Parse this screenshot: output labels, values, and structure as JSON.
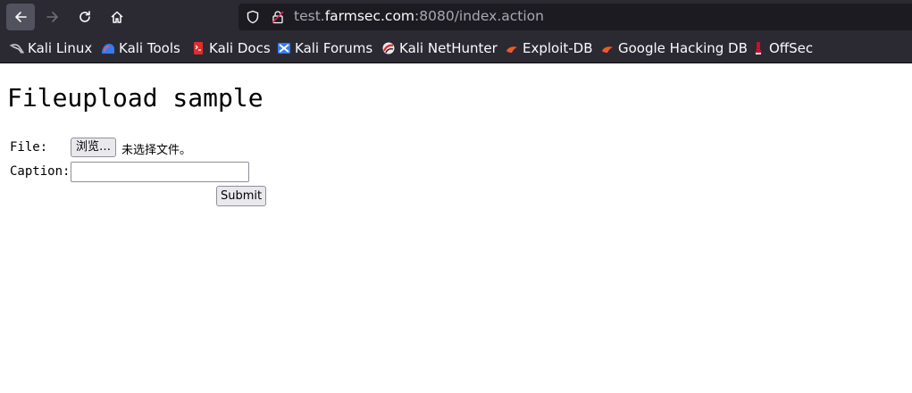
{
  "browser": {
    "url_prefix": "test.",
    "url_domain": "farmsec.com",
    "url_suffix": ":8080/index.action",
    "bookmarks": [
      {
        "label": "Kali Linux",
        "icon": "kali-dragon-icon"
      },
      {
        "label": "Kali Tools",
        "icon": "kali-tools-icon"
      },
      {
        "label": "Kali Docs",
        "icon": "kali-docs-icon"
      },
      {
        "label": "Kali Forums",
        "icon": "kali-forums-icon"
      },
      {
        "label": "Kali NetHunter",
        "icon": "kali-nethunter-icon"
      },
      {
        "label": "Exploit-DB",
        "icon": "exploit-db-icon"
      },
      {
        "label": "Google Hacking DB",
        "icon": "google-hacking-db-icon"
      },
      {
        "label": "OffSec",
        "icon": "offsec-icon"
      }
    ]
  },
  "page": {
    "title": "Fileupload sample",
    "form": {
      "file_label": "File:",
      "browse_label": "浏览…",
      "no_file_text": "未选择文件。",
      "caption_label": "Caption:",
      "caption_value": "",
      "submit_label": "Submit"
    }
  },
  "colors": {
    "toolbar_bg": "#2b2a33",
    "urlbar_bg": "#1c1b22",
    "page_bg": "#ffffff"
  }
}
